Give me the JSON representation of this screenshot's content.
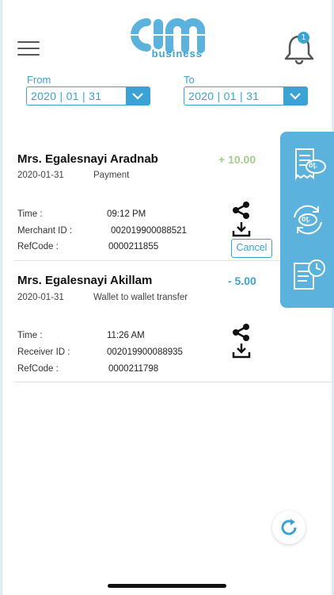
{
  "header": {
    "logo_text": "cim",
    "logo_sub": "business",
    "notification_count": "1"
  },
  "filters": {
    "from_label": "From",
    "from_value": "2020 | 01 | 31",
    "to_label": "To",
    "to_value": "2020 | 01 | 31"
  },
  "transactions": [
    {
      "name": "Mrs. Egalesnayi Aradnab",
      "amount": "+ 10.00",
      "date": "2020-01-31",
      "type": "Payment",
      "time_label": "Time :",
      "time_value": "09:12 PM",
      "id_label": "Merchant ID :",
      "id_value": "002019900088521",
      "ref_label": "RefCode :",
      "ref_value": "0000211855",
      "cancel_label": "Cancel"
    },
    {
      "name": "Mrs.  Egalesnayi Akillam",
      "amount": "- 5.00",
      "date": "2020-01-31",
      "type": "Wallet to wallet transfer",
      "time_label": "Time :",
      "time_value": "11:26 AM",
      "id_label": "Receiver ID :",
      "id_value": "002019900088935",
      "ref_label": "RefCode :",
      "ref_value": "0000211798"
    }
  ],
  "side_panel": {
    "icon_1_text": "öţ.",
    "icon_2_text": "öţ."
  },
  "colors": {
    "accent": "#3aa3d3",
    "panel": "#5bb2dc",
    "positive": "#a4cc8e"
  }
}
